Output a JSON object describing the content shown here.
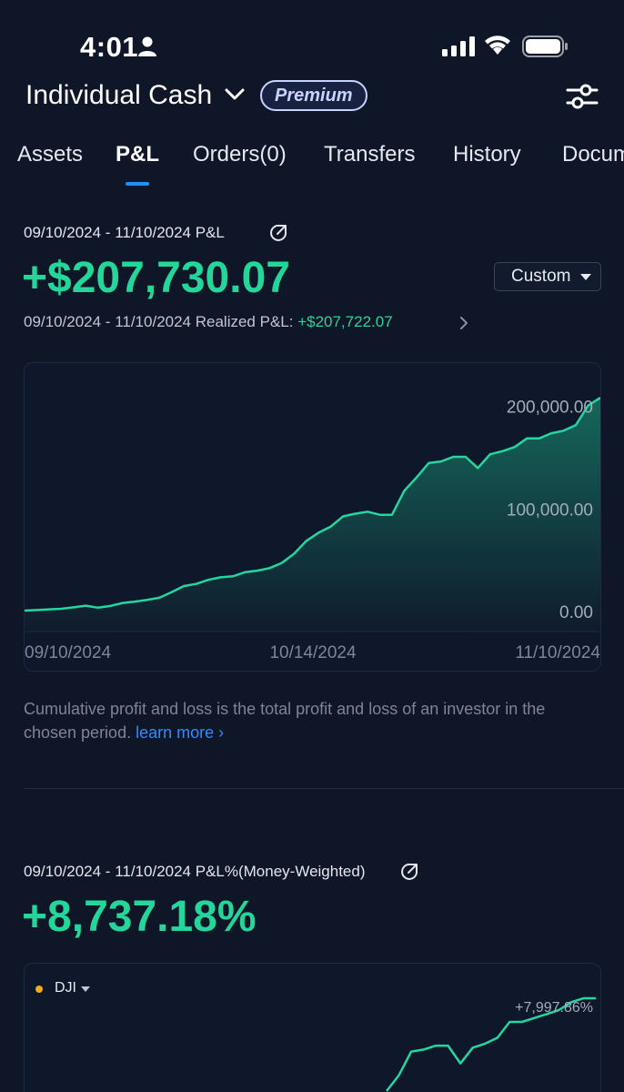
{
  "status_bar": {
    "time": "4:01"
  },
  "header": {
    "account_title": "Individual Cash",
    "badge": "Premium"
  },
  "tabs": [
    {
      "label": "Assets",
      "active": false
    },
    {
      "label": "P&L",
      "active": true
    },
    {
      "label": "Orders(0)",
      "active": false
    },
    {
      "label": "Transfers",
      "active": false
    },
    {
      "label": "History",
      "active": false
    },
    {
      "label": "Documents",
      "active": false
    }
  ],
  "pnl": {
    "range_label": "09/10/2024 - 11/10/2024 P&L",
    "value": "+$207,730.07",
    "period_button": "Custom",
    "realized_label": "09/10/2024 - 11/10/2024 Realized P&L: ",
    "realized_value": "+$207,722.07",
    "description": "Cumulative profit and loss is the total profit and loss of an investor in the chosen period.",
    "learn_more": "learn more"
  },
  "pnl_pct": {
    "range_label": "09/10/2024 - 11/10/2024 P&L%(Money-Weighted)",
    "value": "+8,737.18%",
    "benchmark": "DJI",
    "last_label": "+7,997.86%"
  },
  "colors": {
    "positive": "#24d69a",
    "accent": "#1e90ff",
    "benchmark": "#f5a623"
  },
  "chart_data": [
    {
      "type": "area",
      "title": "",
      "xlabel": "",
      "ylabel": "",
      "x_ticks": [
        "09/10/2024",
        "10/14/2024",
        "11/10/2024"
      ],
      "y_ticks": [
        "0.00",
        "100,000.00",
        "200,000.00"
      ],
      "ylim": [
        0,
        212000
      ],
      "grid": false,
      "values": [
        0,
        500,
        1200,
        1800,
        3200,
        4800,
        2800,
        4500,
        7500,
        8800,
        10500,
        12500,
        18000,
        24000,
        26000,
        30000,
        32500,
        33500,
        37500,
        39000,
        41500,
        46500,
        55500,
        68000,
        76000,
        82000,
        92000,
        94500,
        96500,
        93500,
        93500,
        117000,
        130000,
        144000,
        145500,
        150000,
        150000,
        139000,
        152500,
        155500,
        159500,
        168000,
        168000,
        173000,
        175500,
        181000,
        200000,
        207730
      ]
    },
    {
      "type": "line",
      "title": "",
      "legend": [
        "DJI"
      ],
      "last_value_label": "+7,997.86%",
      "values": [
        3500,
        4300,
        5500,
        5600,
        5800,
        5800,
        4900,
        5700,
        5900,
        6200,
        7000,
        7000,
        7200,
        7400,
        7600,
        8000,
        8200,
        8200
      ]
    }
  ]
}
